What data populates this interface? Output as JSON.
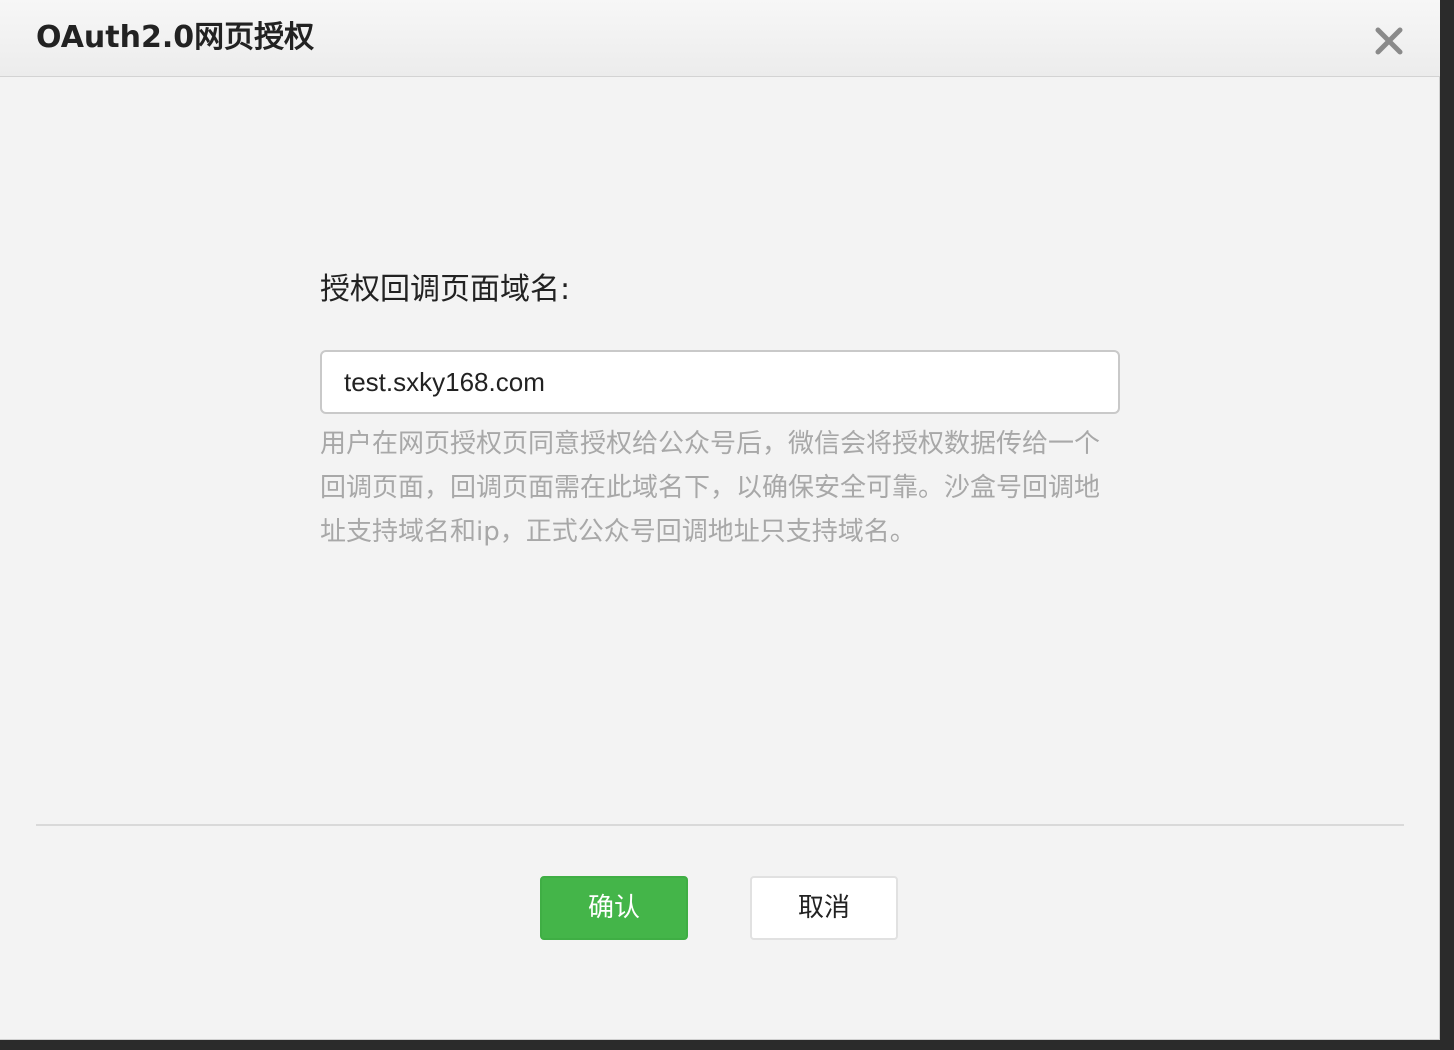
{
  "dialog": {
    "title": "OAuth2.0网页授权",
    "close_icon": "close-icon"
  },
  "form": {
    "label": "授权回调页面域名:",
    "domain_value": "test.sxky168.com",
    "help_text": "用户在网页授权页同意授权给公众号后，微信会将授权数据传给一个回调页面，回调页面需在此域名下，以确保安全可靠。沙盒号回调地址支持域名和ip，正式公众号回调地址只支持域名。"
  },
  "buttons": {
    "confirm_label": "确认",
    "cancel_label": "取消"
  },
  "colors": {
    "confirm_bg": "#44b549",
    "help_text": "#a8a8a8"
  }
}
